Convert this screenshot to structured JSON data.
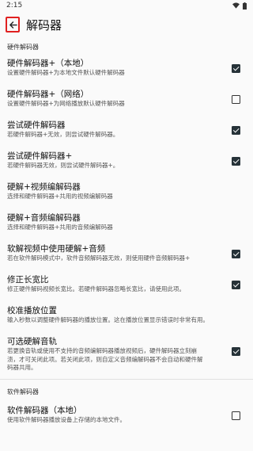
{
  "status": {
    "time": "2:15"
  },
  "appbar": {
    "title": "解码器"
  },
  "sections": [
    {
      "header": "硬件解码器"
    },
    {
      "header": "软件解码器"
    }
  ],
  "prefs": [
    {
      "title": "硬件解码器+（本地）",
      "summary": "设置硬件解码器+为本地文件默认硬件解码器",
      "checked": true
    },
    {
      "title": "硬件解码器+（网络）",
      "summary": "设置硬件解码器+为网络播放默认硬件解码器",
      "checked": false
    },
    {
      "title": "尝试硬件解码器",
      "summary": "若硬件解码器+无效，则尝试硬件解码器。",
      "checked": true
    },
    {
      "title": "尝试硬件解码器+",
      "summary": "若硬件解码器无效，则尝试硬件解码器+。",
      "checked": true
    },
    {
      "title": "硬解+视频编解码器",
      "summary": "选择和硬件解码器+共用的视频编解码器"
    },
    {
      "title": "硬解+音频编解码器",
      "summary": "选择和硬件解码器+共用的音频编解码器"
    },
    {
      "title": "软解视频中使用硬解+音频",
      "summary": "若在软件解码模式中，软件音频解码器无效，则使用硬件音频解码器+",
      "checked": true
    },
    {
      "title": "修正长宽比",
      "summary": "修正硬件解码视频长宽比。若硬件解码器忽略长宽比，请使用此项。",
      "checked": true
    },
    {
      "title": "校准播放位置",
      "summary": "输入秒数以调整硬件解码器的播放位置。这在播放位置显示错误时非常有用。"
    },
    {
      "title": "可选硬解音轨",
      "summary_lines": [
        "若更换音轨或使用不支持的音频编解码器播放视频后，硬件解码器立刻崩",
        "溃，才可关闭此项。若关闭此项，则自定义音频编解码器不会自动和硬件解",
        "码器共用。"
      ],
      "checked": true
    },
    {
      "title": "软件解码器（本地）",
      "summary": "使用软件解码器播放设备上存储的本地文件。",
      "checked": false
    }
  ]
}
